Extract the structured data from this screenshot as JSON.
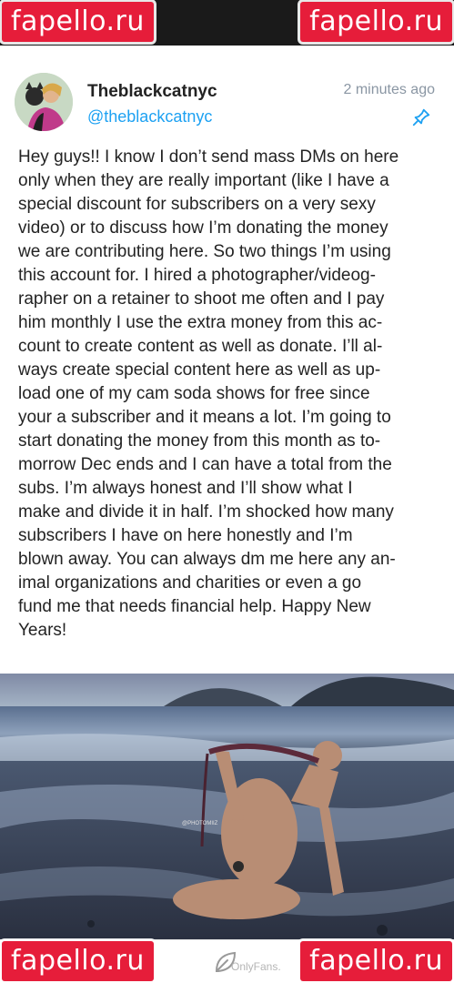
{
  "watermarks": {
    "text": "fapello.ru"
  },
  "post": {
    "display_name": "Theblackcatnyc",
    "handle": "@theblackcatnyc",
    "timestamp": "2 minutes ago",
    "text": "Hey guys!! I know I don’t send mass DMs on here\nonly when they are really important (like I have a\nspecial discount for subscribers on a very sexy\nvideo) or to discuss how I’m donating the money\nwe are contributing here. So two things I’m using\nthis account for. I hired a photographer/videog-\nrapher on a retainer to shoot me often and I pay\nhim monthly I use the extra money from this ac-\ncount to create content as well as donate. I’ll al-\nways create special content here as well as up-\nload one of my cam soda shows for free since\nyour a subscriber and it means a lot. I’m going to\nstart donating the money from this month as to-\nmorrow Dec ends and I can have a total from the\nsubs. I’m always honest and I’ll show what I\nmake and divide it in half. I’m shocked how many\nsubscribers I have on here honestly and I’m\nblown away. You can always dm me here any an-\nimal organizations and charities or even a go\nfund me that needs financial help. Happy New\nYears!",
    "photo_credit": "@PHOTOMIIZ"
  },
  "bottom": {
    "site_watermark": "OnlyFans."
  },
  "colors": {
    "accent": "#1da1f2",
    "watermark_bg": "#e61d3a",
    "timestamp": "#8a96a3"
  },
  "icons": {
    "pin": "pin-icon",
    "leaf": "leaf-icon"
  }
}
